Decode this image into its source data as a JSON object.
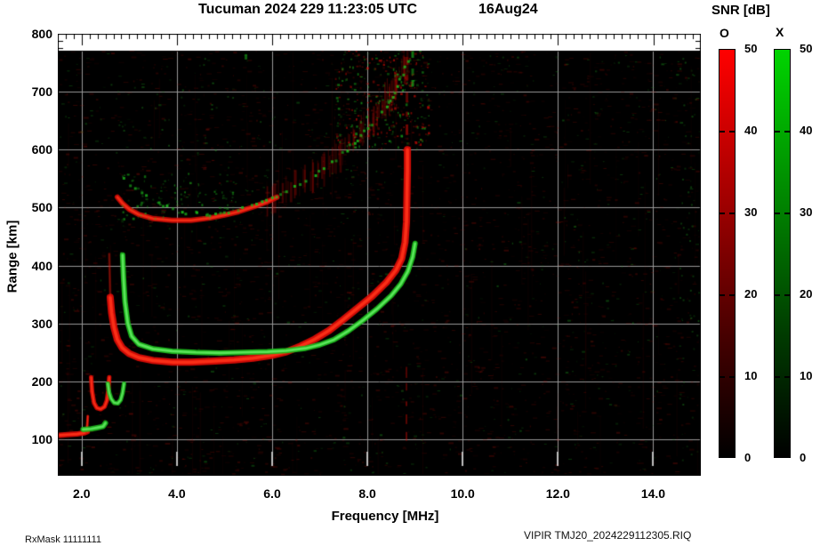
{
  "header": {
    "title": "Tucuman 2024 229 11:23:05 UTC",
    "date": "16Aug24"
  },
  "footer": {
    "rx_mask": "RxMask 11111111",
    "file_id": "VIPIR  TMJ20_2024229112305.RIQ"
  },
  "chart_data": {
    "type": "heatmap",
    "title": "Tucuman 2024 229 11:23:05 UTC   16Aug24",
    "xlabel": "Frequency [MHz]",
    "ylabel": "Range [km]",
    "xlim": [
      1.5,
      15.0
    ],
    "ylim": [
      37,
      800
    ],
    "data_top_km": 771,
    "grid": true,
    "grid_color": "#999999",
    "background": "#000000",
    "x_ticks": [
      2,
      4,
      6,
      8,
      10,
      12,
      14
    ],
    "x_tick_labels": [
      "2.0",
      "4.0",
      "6.0",
      "8.0",
      "10.0",
      "12.0",
      "14.0"
    ],
    "x_minor_tick_step_mhz": 0.1667,
    "y_ticks": [
      100,
      200,
      300,
      400,
      500,
      600,
      700,
      800
    ],
    "y_tick_labels": [
      "100",
      "200",
      "300",
      "400",
      "500",
      "600",
      "700",
      "800"
    ],
    "y_minor_tick_step_km": 12.5,
    "colorbar": {
      "title": "SNR [dB]",
      "range_db": [
        0,
        50
      ],
      "ticks": [
        0,
        10,
        20,
        30,
        40,
        50
      ],
      "bars": [
        {
          "mode": "O",
          "label": "O",
          "color_hex": "#ff0000"
        },
        {
          "mode": "X",
          "label": "X",
          "color_hex": "#00d400"
        }
      ]
    },
    "traces": [
      {
        "name": "F-1hop-O-main",
        "mode": "O",
        "style": "band",
        "width": 8,
        "alpha": 0.95,
        "points": [
          [
            2.6,
            345
          ],
          [
            2.63,
            318
          ],
          [
            2.68,
            293
          ],
          [
            2.75,
            272
          ],
          [
            2.85,
            258
          ],
          [
            3.0,
            248
          ],
          [
            3.2,
            241
          ],
          [
            3.5,
            236
          ],
          [
            3.9,
            233
          ],
          [
            4.3,
            233
          ],
          [
            4.8,
            235
          ],
          [
            5.2,
            237
          ],
          [
            5.6,
            240
          ],
          [
            6.0,
            245
          ],
          [
            6.3,
            251
          ],
          [
            6.6,
            261
          ],
          [
            6.9,
            273
          ],
          [
            7.2,
            288
          ],
          [
            7.5,
            307
          ],
          [
            7.8,
            327
          ],
          [
            8.1,
            347
          ],
          [
            8.4,
            371
          ],
          [
            8.6,
            392
          ],
          [
            8.72,
            412
          ],
          [
            8.79,
            440
          ],
          [
            8.82,
            475
          ],
          [
            8.83,
            520
          ],
          [
            8.84,
            565
          ],
          [
            8.84,
            600
          ]
        ]
      },
      {
        "name": "F-1hop-O-asymptote-dashes",
        "mode": "O",
        "style": "dashes-v",
        "width": 3,
        "alpha": 0.55,
        "points": [
          [
            8.83,
            615
          ],
          [
            8.83,
            760
          ]
        ]
      },
      {
        "name": "F-1hop-O-left-faint",
        "mode": "O",
        "style": "band",
        "width": 3,
        "alpha": 0.3,
        "points": [
          [
            2.58,
            420
          ],
          [
            2.59,
            385
          ],
          [
            2.6,
            348
          ]
        ]
      },
      {
        "name": "F-1hop-X-main",
        "mode": "X",
        "style": "band",
        "width": 6,
        "alpha": 0.95,
        "points": [
          [
            2.86,
            418
          ],
          [
            2.88,
            378
          ],
          [
            2.91,
            338
          ],
          [
            2.97,
            300
          ],
          [
            3.05,
            278
          ],
          [
            3.2,
            264
          ],
          [
            3.5,
            256
          ],
          [
            3.9,
            252
          ],
          [
            4.4,
            250
          ],
          [
            4.9,
            249
          ],
          [
            5.4,
            250
          ],
          [
            5.9,
            251
          ],
          [
            6.3,
            253
          ],
          [
            6.7,
            257
          ],
          [
            7.0,
            263
          ],
          [
            7.3,
            272
          ],
          [
            7.6,
            287
          ],
          [
            7.9,
            305
          ],
          [
            8.2,
            325
          ],
          [
            8.5,
            348
          ],
          [
            8.7,
            368
          ],
          [
            8.85,
            390
          ],
          [
            8.95,
            415
          ],
          [
            9.0,
            438
          ]
        ]
      },
      {
        "name": "Es-O-band",
        "mode": "O",
        "style": "band",
        "width": 6,
        "alpha": 0.95,
        "points": [
          [
            1.53,
            107
          ],
          [
            1.7,
            108
          ],
          [
            1.9,
            109
          ],
          [
            2.05,
            111
          ],
          [
            2.12,
            113
          ]
        ]
      },
      {
        "name": "Es-O-spike",
        "mode": "O",
        "style": "band",
        "width": 3,
        "alpha": 0.8,
        "points": [
          [
            2.1,
            113
          ],
          [
            2.12,
            126
          ],
          [
            2.13,
            140
          ]
        ]
      },
      {
        "name": "E-O-cusp",
        "mode": "O",
        "style": "band",
        "width": 5,
        "alpha": 0.9,
        "points": [
          [
            2.2,
            207
          ],
          [
            2.22,
            182
          ],
          [
            2.26,
            163
          ],
          [
            2.32,
            154
          ],
          [
            2.4,
            152
          ],
          [
            2.48,
            156
          ],
          [
            2.53,
            167
          ],
          [
            2.56,
            184
          ],
          [
            2.58,
            207
          ]
        ]
      },
      {
        "name": "E-X-cusp",
        "mode": "X",
        "style": "band",
        "width": 5,
        "alpha": 0.9,
        "points": [
          [
            2.55,
            196
          ],
          [
            2.58,
            180
          ],
          [
            2.62,
            170
          ],
          [
            2.68,
            163
          ],
          [
            2.76,
            162
          ],
          [
            2.82,
            168
          ],
          [
            2.86,
            180
          ],
          [
            2.89,
            196
          ]
        ]
      },
      {
        "name": "Es-X-band",
        "mode": "X",
        "style": "band",
        "width": 6,
        "alpha": 0.9,
        "points": [
          [
            2.03,
            117
          ],
          [
            2.2,
            118
          ],
          [
            2.33,
            120
          ],
          [
            2.45,
            122
          ],
          [
            2.5,
            128
          ]
        ]
      },
      {
        "name": "F-2hop-O-arc",
        "mode": "O",
        "style": "band",
        "width": 6,
        "alpha": 0.85,
        "points": [
          [
            2.75,
            518
          ],
          [
            2.85,
            508
          ],
          [
            3.0,
            497
          ],
          [
            3.2,
            488
          ],
          [
            3.5,
            481
          ],
          [
            3.9,
            478
          ],
          [
            4.3,
            478
          ],
          [
            4.7,
            482
          ],
          [
            5.0,
            487
          ],
          [
            5.3,
            493
          ],
          [
            5.6,
            501
          ],
          [
            5.9,
            510
          ],
          [
            6.1,
            518
          ]
        ]
      },
      {
        "name": "F-2hop-O-spread",
        "mode": "O",
        "style": "diffuse",
        "width": 26,
        "alpha": 0.22,
        "points": [
          [
            5.9,
            515
          ],
          [
            6.2,
            526
          ],
          [
            6.5,
            538
          ],
          [
            6.8,
            553
          ],
          [
            7.1,
            570
          ],
          [
            7.4,
            592
          ],
          [
            7.7,
            617
          ],
          [
            8.0,
            644
          ],
          [
            8.3,
            674
          ],
          [
            8.55,
            706
          ],
          [
            8.7,
            732
          ],
          [
            8.8,
            756
          ]
        ]
      },
      {
        "name": "F-2hop-X-dotted",
        "mode": "X",
        "style": "dots",
        "width": 4,
        "alpha": 0.9,
        "points": [
          [
            2.88,
            552
          ],
          [
            3.05,
            538
          ],
          [
            3.25,
            524
          ],
          [
            3.5,
            511
          ],
          [
            3.8,
            500
          ],
          [
            4.1,
            493
          ],
          [
            4.4,
            489
          ],
          [
            4.8,
            488
          ],
          [
            5.1,
            491
          ],
          [
            5.4,
            497
          ],
          [
            5.7,
            505
          ],
          [
            6.0,
            514
          ],
          [
            6.3,
            525
          ],
          [
            6.6,
            539
          ],
          [
            6.9,
            555
          ],
          [
            7.2,
            573
          ],
          [
            7.5,
            594
          ],
          [
            7.8,
            618
          ],
          [
            8.1,
            644
          ],
          [
            8.4,
            673
          ],
          [
            8.6,
            700
          ],
          [
            8.75,
            728
          ],
          [
            8.87,
            758
          ]
        ]
      },
      {
        "name": "F-2hop-X-asymptote-dashes",
        "mode": "X",
        "style": "dashes-v",
        "width": 3,
        "alpha": 0.8,
        "points": [
          [
            8.95,
            700
          ],
          [
            8.95,
            770
          ]
        ]
      },
      {
        "name": "interference-column-low",
        "mode": "O",
        "style": "dashes-v",
        "width": 2,
        "alpha": 0.55,
        "points": [
          [
            8.82,
            80
          ],
          [
            8.82,
            225
          ]
        ]
      },
      {
        "name": "top-green-dashes",
        "mode": "X",
        "style": "dashes-v",
        "width": 3,
        "alpha": 0.6,
        "points": [
          [
            5.45,
            745
          ],
          [
            5.45,
            798
          ]
        ]
      },
      {
        "name": "top-right-speckle",
        "mode": "mix",
        "style": "speckle",
        "alpha": 0.55,
        "count": 430,
        "points": [
          [
            7.3,
            600
          ],
          [
            9.3,
            798
          ]
        ]
      },
      {
        "name": "second-hop-left-speckle",
        "mode": "X",
        "style": "speckle",
        "alpha": 0.5,
        "count": 90,
        "points": [
          [
            2.8,
            480
          ],
          [
            5.2,
            560
          ]
        ]
      }
    ]
  }
}
